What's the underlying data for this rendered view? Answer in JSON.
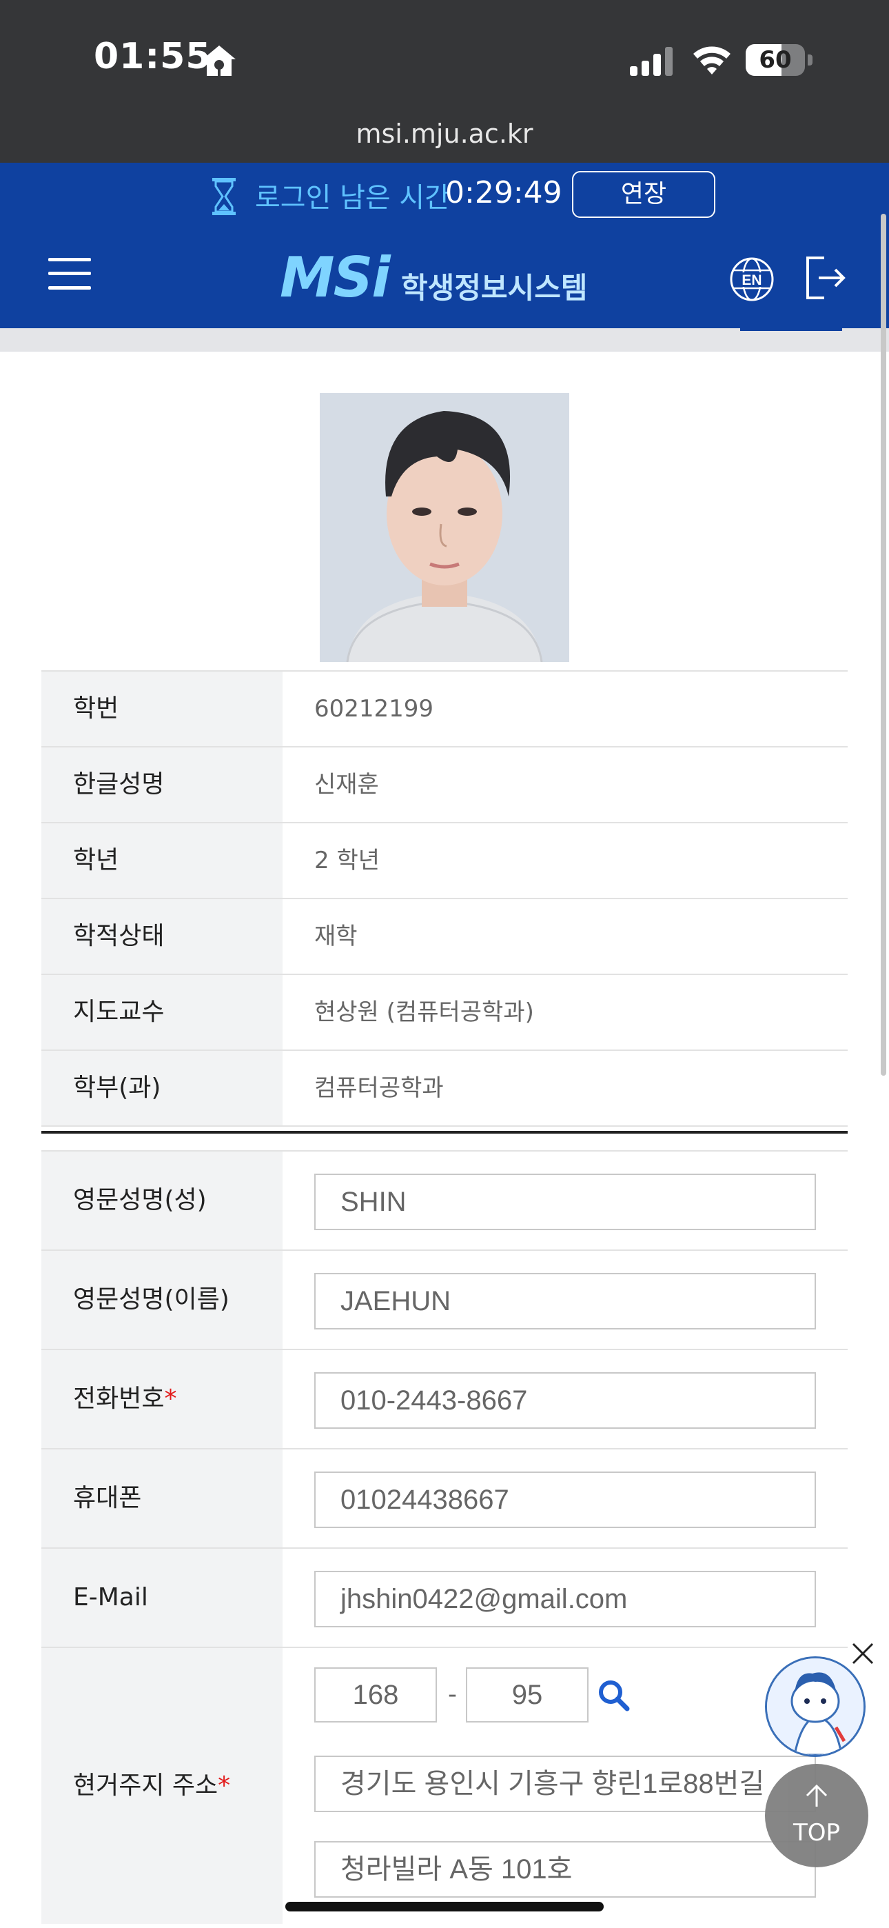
{
  "status_bar": {
    "time": "01:55",
    "battery_level": "60",
    "battery_fraction": 0.6
  },
  "browser": {
    "url": "msi.mju.ac.kr"
  },
  "header": {
    "timer_label": "로그인 남은 시간",
    "timer_value": "0:29:49",
    "extend_button": "연장",
    "logo_mark": "MSi",
    "logo_text": "학생정보시스템",
    "language_button": "EN"
  },
  "student_info": [
    {
      "label": "학번",
      "value": "60212199"
    },
    {
      "label": "한글성명",
      "value": "신재훈"
    },
    {
      "label": "학년",
      "value": "2 학년"
    },
    {
      "label": "학적상태",
      "value": "재학"
    },
    {
      "label": "지도교수",
      "value": "현상원 (컴퓨터공학과)"
    },
    {
      "label": "학부(과)",
      "value": "컴퓨터공학과"
    }
  ],
  "form": {
    "english_last": {
      "label": "영문성명(성)",
      "value": "SHIN"
    },
    "english_first": {
      "label": "영문성명(이름)",
      "value": "JAEHUN"
    },
    "phone": {
      "label": "전화번호",
      "required_mark": "*",
      "value": "010-2443-8667"
    },
    "mobile": {
      "label": "휴대폰",
      "value": "01024438667"
    },
    "email": {
      "label": "E-Mail",
      "value": "jhshin0422@gmail.com"
    },
    "address": {
      "label": "현거주지 주소",
      "required_mark": "*",
      "zip1": "168",
      "zip_sep": "-",
      "zip2": "95",
      "line1": "경기도 용인시 기흥구 향린1로88번길",
      "line2": "청라빌라 A동 101호"
    }
  },
  "floating": {
    "top_button": "TOP"
  },
  "colors": {
    "header_blue": "#0f41a0",
    "timer_label": "#5fc2ff",
    "required": "#e21b1b"
  }
}
